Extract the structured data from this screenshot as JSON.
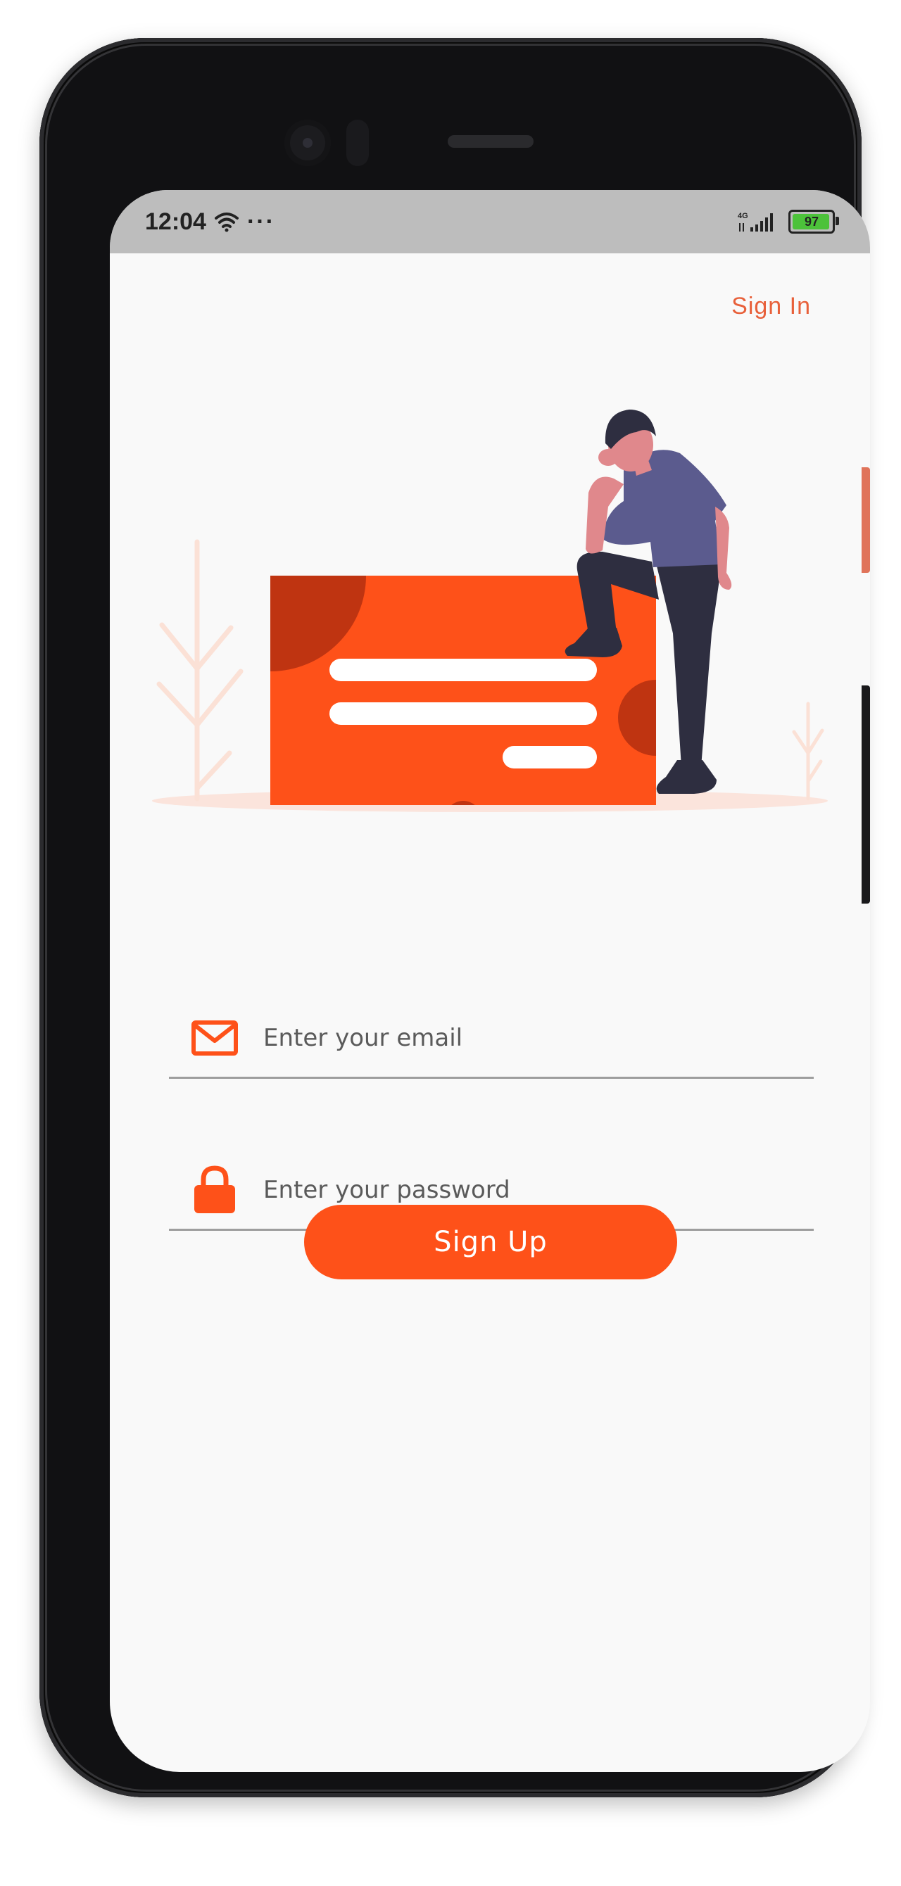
{
  "status_bar": {
    "time": "12:04",
    "more": "···",
    "network": "4G",
    "battery": "97"
  },
  "header": {
    "sign_in_label": "Sign In"
  },
  "form": {
    "email_placeholder": "Enter your email",
    "password_placeholder": "Enter your password",
    "submit_label": "Sign Up"
  },
  "colors": {
    "accent": "#fe5119",
    "accent_dark": "#bf3411",
    "link": "#e8603a",
    "person_shirt": "#5b5b8e",
    "person_pants": "#2e2e40",
    "skin": "#e0888c"
  },
  "icons": {
    "email": "envelope-icon",
    "password": "lock-icon",
    "wifi": "wifi-icon",
    "signal": "signal-icon"
  }
}
